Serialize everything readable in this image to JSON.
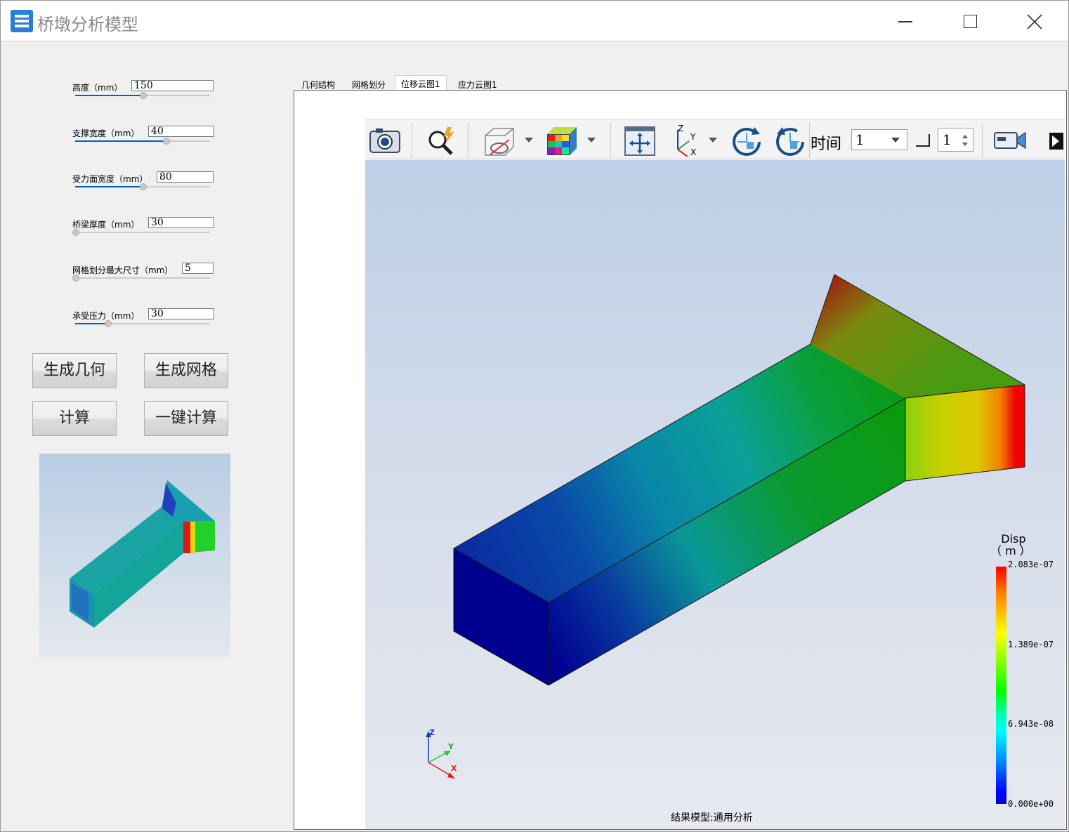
{
  "window": {
    "title": "桥墩分析模型"
  },
  "params": [
    {
      "label": "高度（mm）",
      "value": "150",
      "fill": 0.5
    },
    {
      "label": "支撑宽度（mm）",
      "value": "40",
      "fill": 0.67
    },
    {
      "label": "受力面宽度（mm）",
      "value": "80",
      "fill": 0.5
    },
    {
      "label": "桥梁厚度（mm）",
      "value": "30",
      "fill": 0.0
    },
    {
      "label": "网格划分最大尺寸（mm）",
      "value": "5",
      "fill": 0.0
    },
    {
      "label": "承受压力（mm）",
      "value": "30",
      "fill": 0.24
    }
  ],
  "buttons": {
    "gen_geometry": "生成几何",
    "gen_mesh": "生成网格",
    "compute": "计算",
    "one_click": "一键计算"
  },
  "tabs": [
    {
      "label": "几何结构",
      "active": false
    },
    {
      "label": "网格划分",
      "active": false
    },
    {
      "label": "位移云图1",
      "active": true
    },
    {
      "label": "应力云图1",
      "active": false
    }
  ],
  "toolbar": {
    "icons": [
      "camera-icon",
      "magnify-icon",
      "visibility-icon",
      "color-cube-icon",
      "fit-view-icon",
      "axes-icon",
      "rotate-cw-icon",
      "rotate-ccw-icon",
      "video-icon",
      "more-icon"
    ],
    "time_label": "时间",
    "time_value": "1",
    "step_value": "1"
  },
  "legend": {
    "title": "Disp",
    "unit": "（ m ）",
    "ticks": [
      "2.083e-07",
      "1.389e-07",
      "6.943e-08",
      "0.000e+00"
    ],
    "colors": {
      "max": "#ff0000",
      "min": "#0000ff"
    }
  },
  "status": {
    "text": "结果模型:通用分析"
  },
  "axis_labels": {
    "x": "X",
    "y": "Y",
    "z": "Z"
  },
  "colors": {
    "accent": "#0a5fb4",
    "window_bg": "#f0f0f0"
  }
}
